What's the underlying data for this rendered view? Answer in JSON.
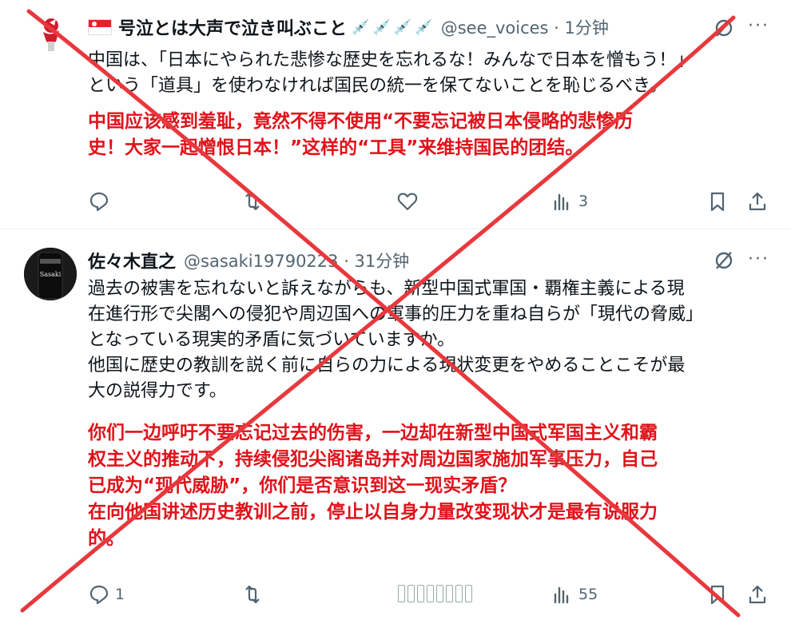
{
  "posts": [
    {
      "name": "号泣とは大声で泣き叫ぶこと",
      "syringe_icon": "💉",
      "handle_time": "@see_voices · 1分钟",
      "lines": [
        "中国は、「日本にやられた悲惨な歴史を忘れるな！みんなで日本を憎もう！」",
        "という「道具」を使わなければ国民の統一を保てないことを恥じるべき。"
      ],
      "translation": [
        "中国应该感到羞耻，竟然不得不使用“不要忘记被日本侵略的悲惨历",
        "史！大家一起憎恨日本！”这样的“工具”来维持国民的团结。"
      ],
      "views": "3",
      "replies": "",
      "more": "···"
    },
    {
      "name": "佐々木直之",
      "handle_time": "@sasaki19790223 · 31分钟",
      "avatar_label": "Sasaki",
      "lines": [
        "過去の被害を忘れないと訴えながらも、新型中国式軍国・覇権主義による現",
        "在進行形で尖閣への侵犯や周辺国への軍事的圧力を重ね自らが「現代の脅威」",
        "となっている現実的矛盾に気づいていますか。",
        "他国に歴史の教訓を説く前に自らの力による現状変更をやめることこそが最",
        "大の説得力です。"
      ],
      "translation": [
        "你们一边呼吁不要忘记过去的伤害，一边却在新型中国式军国主义和霸",
        "权主义的推动下，持续侵犯尖阁诸岛并对周边国家施加军事压力，自己",
        "已成为“现代威胁”，你们是否意识到这一现实矛盾？",
        "在向他国讲述历史教训之前，停止以自身力量改变现状才是最有说服力",
        "的。"
      ],
      "views": "55",
      "replies": "1",
      "more": "···"
    }
  ],
  "colors": {
    "translation": "#e0121a",
    "x_mark": "#e8383d",
    "muted": "#536471"
  }
}
